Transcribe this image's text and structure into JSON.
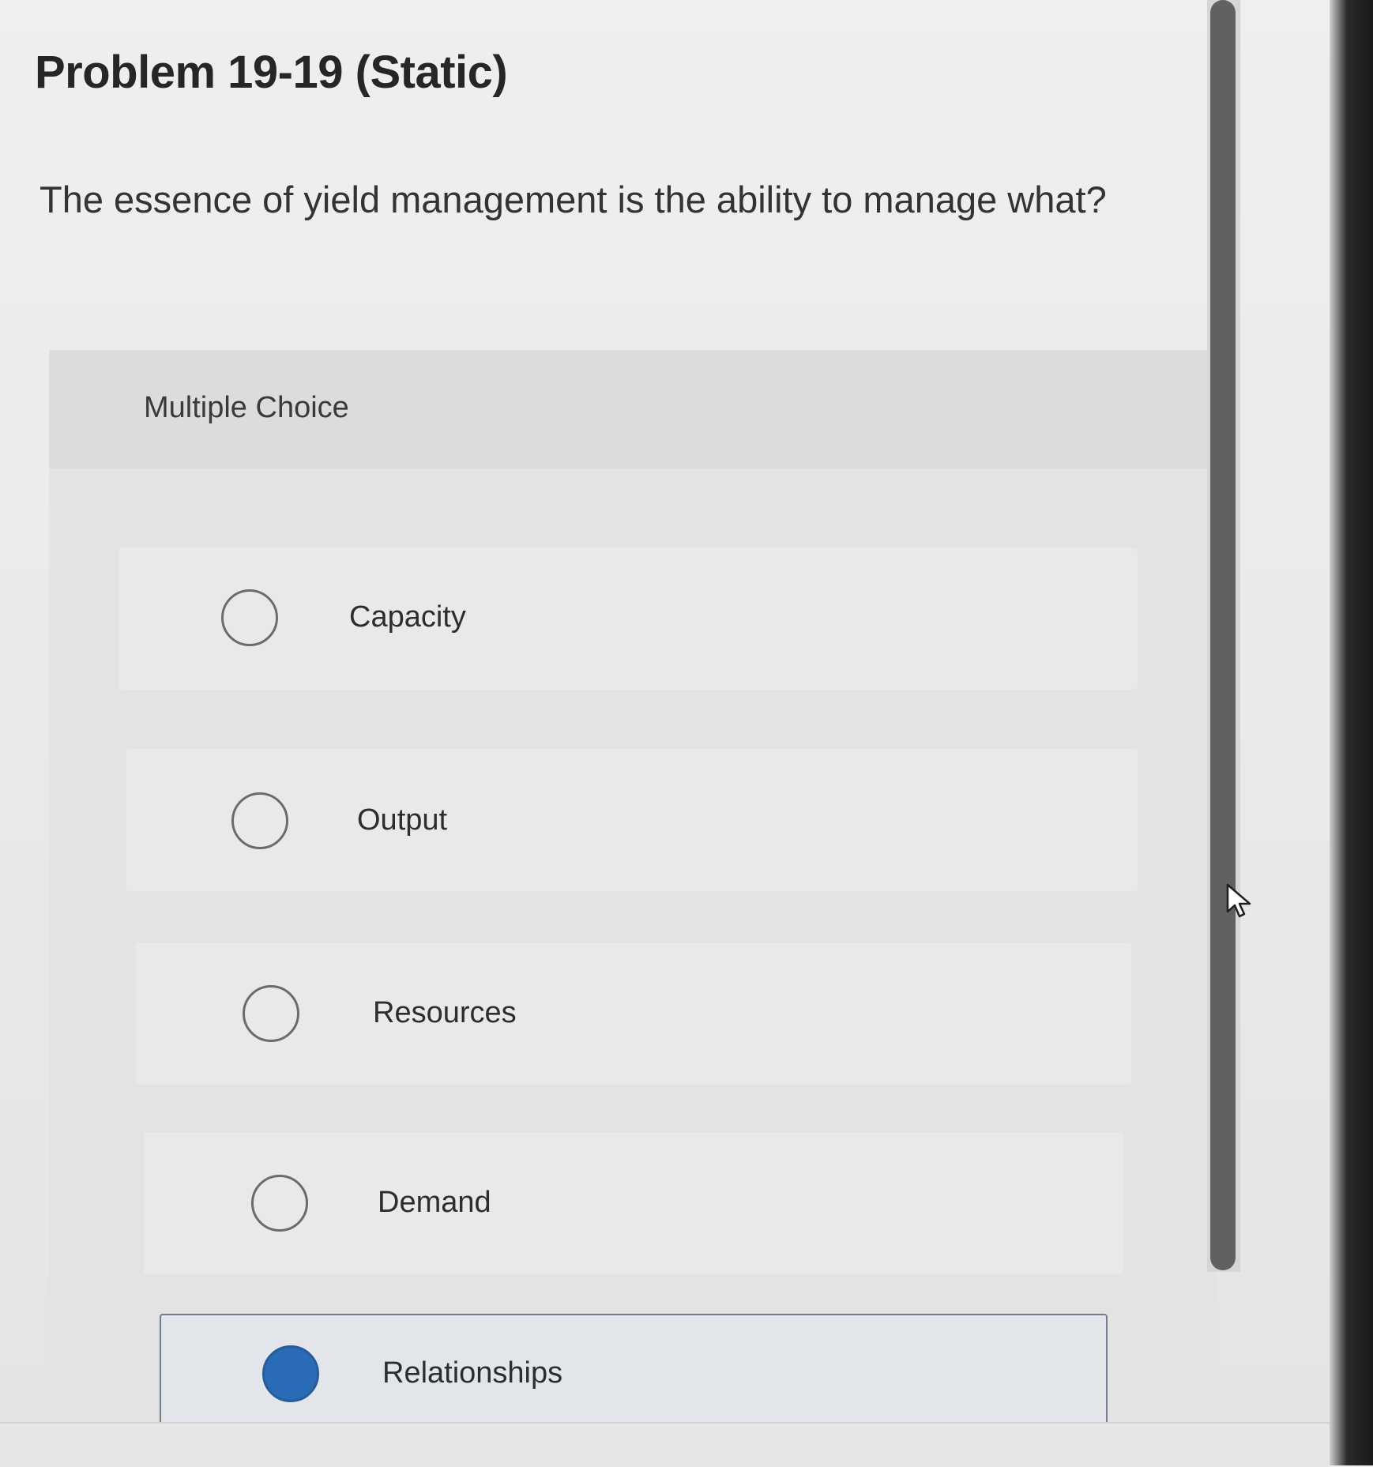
{
  "problem": {
    "title": "Problem 19-19 (Static)",
    "question": "The essence of yield management is the ability to manage what?"
  },
  "multiple_choice": {
    "label": "Multiple Choice",
    "options": [
      {
        "label": "Capacity",
        "selected": false
      },
      {
        "label": "Output",
        "selected": false
      },
      {
        "label": "Resources",
        "selected": false
      },
      {
        "label": "Demand",
        "selected": false
      },
      {
        "label": "Relationships",
        "selected": true
      }
    ]
  },
  "icons": {
    "cursor": "mouse-pointer-icon"
  },
  "colors": {
    "selected_radio": "#2a6bb6",
    "scrollbar_thumb": "#5f6163"
  }
}
